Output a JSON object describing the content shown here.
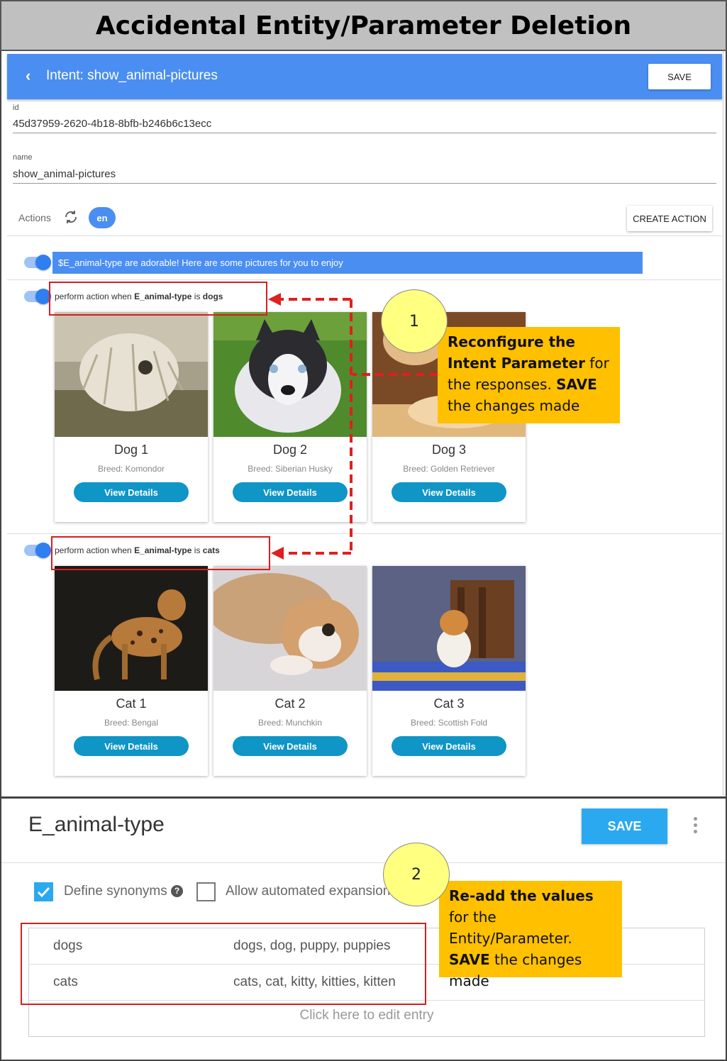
{
  "slide_title": "Accidental Entity/Parameter Deletion",
  "intent_header": {
    "back_icon": "chevron-left-icon",
    "title": "Intent: show_animal-pictures",
    "save_label": "SAVE"
  },
  "fields": {
    "id_label": "id",
    "id_value": "45d37959-2620-4b18-8bfb-b246b6c13ecc",
    "name_label": "name",
    "name_value": "show_animal-pictures"
  },
  "actions": {
    "label": "Actions",
    "lang": "en",
    "create_label": "CREATE ACTION"
  },
  "message_text": "$E_animal-type are adorable! Here are some pictures for you to enjoy",
  "conditions": {
    "dogs": {
      "prefix": "perform action when ",
      "param": "E_animal-type",
      "mid": " is ",
      "value": "dogs"
    },
    "cats": {
      "prefix": "perform action when ",
      "param": "E_animal-type",
      "mid": " is ",
      "value": "cats"
    }
  },
  "dog_cards": [
    {
      "name": "Dog 1",
      "breed": "Breed: Komondor",
      "button": "View Details"
    },
    {
      "name": "Dog 2",
      "breed": "Breed: Siberian Husky",
      "button": "View Details"
    },
    {
      "name": "Dog 3",
      "breed": "Breed: Golden Retriever",
      "button": "View Details"
    }
  ],
  "cat_cards": [
    {
      "name": "Cat 1",
      "breed": "Breed: Bengal",
      "button": "View Details"
    },
    {
      "name": "Cat 2",
      "breed": "Breed: Munchkin",
      "button": "View Details"
    },
    {
      "name": "Cat 3",
      "breed": "Breed: Scottish Fold",
      "button": "View Details"
    }
  ],
  "callout1": {
    "number": "1",
    "b1": "Reconfigure the Intent Parameter",
    "t1": " for the responses. ",
    "b2": "SAVE",
    "t2": " the changes made"
  },
  "entity": {
    "title": "E_animal-type",
    "save_label": "SAVE",
    "define_synonyms": "Define synonyms",
    "help_icon": "?",
    "allow_expansion": "Allow automated expansion",
    "rows": [
      {
        "value": "dogs",
        "synonyms": "dogs, dog, puppy, puppies"
      },
      {
        "value": "cats",
        "synonyms": "cats, cat, kitty, kitties, kitten"
      }
    ],
    "edit_placeholder": "Click here to edit entry"
  },
  "callout2": {
    "number": "2",
    "b1": "Re-add the values",
    "t1": " for the Entity/Parameter. ",
    "b2": "SAVE",
    "t2": " the changes made"
  },
  "colors": {
    "header_blue": "#4a8ef2",
    "button_teal": "#0f95c6",
    "entity_save": "#2aa9f0",
    "callout_bg": "#ffc000",
    "callout_circle": "#ffff80",
    "annotation_red": "#d81e1e"
  }
}
